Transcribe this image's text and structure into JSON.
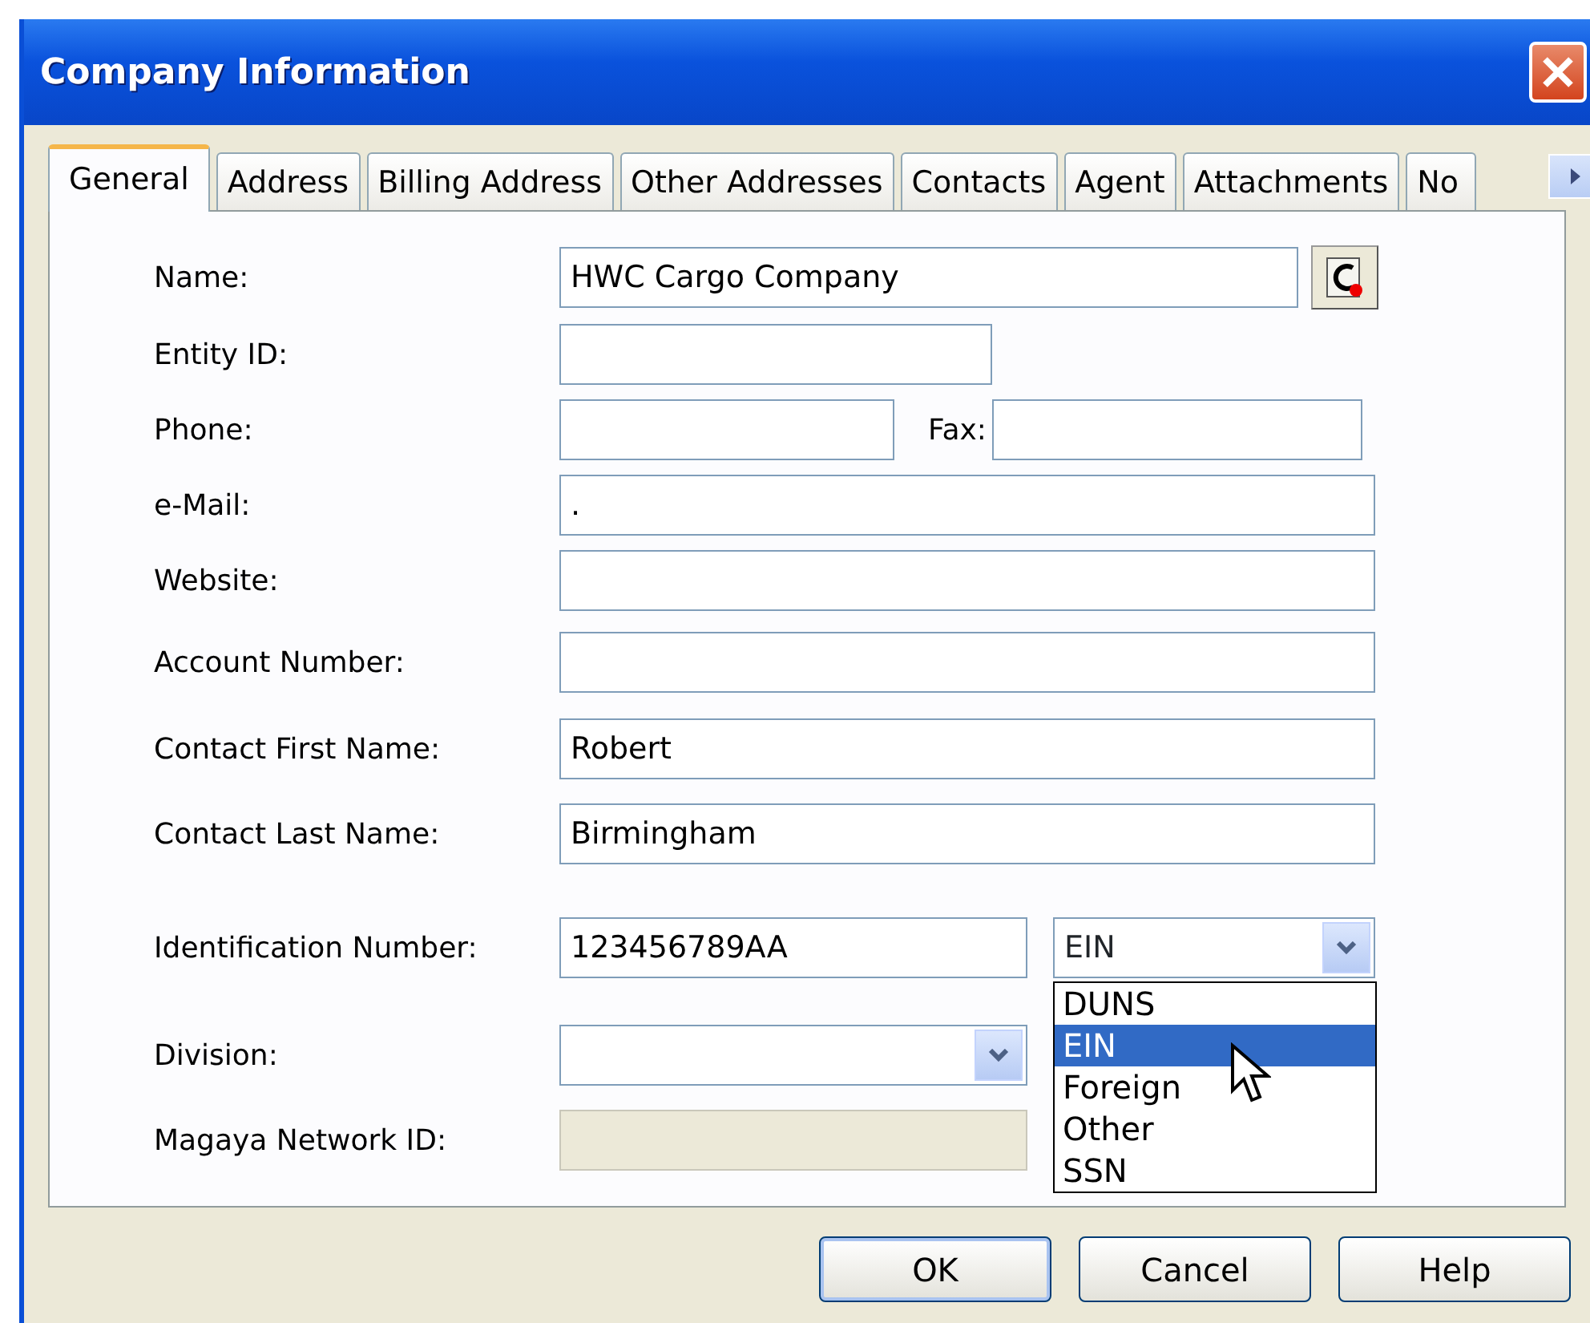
{
  "window": {
    "title": "Company Information"
  },
  "tabs": [
    {
      "label": "General",
      "selected": true
    },
    {
      "label": "Address",
      "selected": false
    },
    {
      "label": "Billing Address",
      "selected": false
    },
    {
      "label": "Other Addresses",
      "selected": false
    },
    {
      "label": "Contacts",
      "selected": false
    },
    {
      "label": "Agent",
      "selected": false
    },
    {
      "label": "Attachments",
      "selected": false
    },
    {
      "label": "No",
      "selected": false
    }
  ],
  "fields": [
    {
      "kind": "lookup",
      "label": "Name:",
      "value": "HWC Cargo Company"
    },
    {
      "kind": "short",
      "label": "Entity ID:"
    },
    {
      "kind": "pair",
      "label": "Phone:",
      "second_label": "Fax:"
    },
    {
      "kind": "text",
      "label": "e-Mail:",
      "value": "."
    },
    {
      "kind": "text",
      "label": "Website:"
    },
    {
      "kind": "text",
      "label": "Account Number:"
    },
    {
      "kind": "text",
      "label": "Contact First Name:",
      "value": "Robert"
    },
    {
      "kind": "text",
      "label": "Contact Last Name:",
      "value": "Birmingham"
    },
    {
      "kind": "id_type",
      "label": "Identification Number:",
      "value": "123456789AA",
      "type_value": "EIN",
      "options": [
        {
          "label": "DUNS",
          "selected": false
        },
        {
          "label": "EIN",
          "selected": true
        },
        {
          "label": "Foreign",
          "selected": false
        },
        {
          "label": "Other",
          "selected": false
        },
        {
          "label": "SSN",
          "selected": false
        }
      ]
    },
    {
      "kind": "dropdown",
      "label": "Division:"
    },
    {
      "kind": "readonly",
      "label": "Magaya Network ID:"
    }
  ],
  "buttons": [
    "OK",
    "Cancel",
    "Help"
  ]
}
